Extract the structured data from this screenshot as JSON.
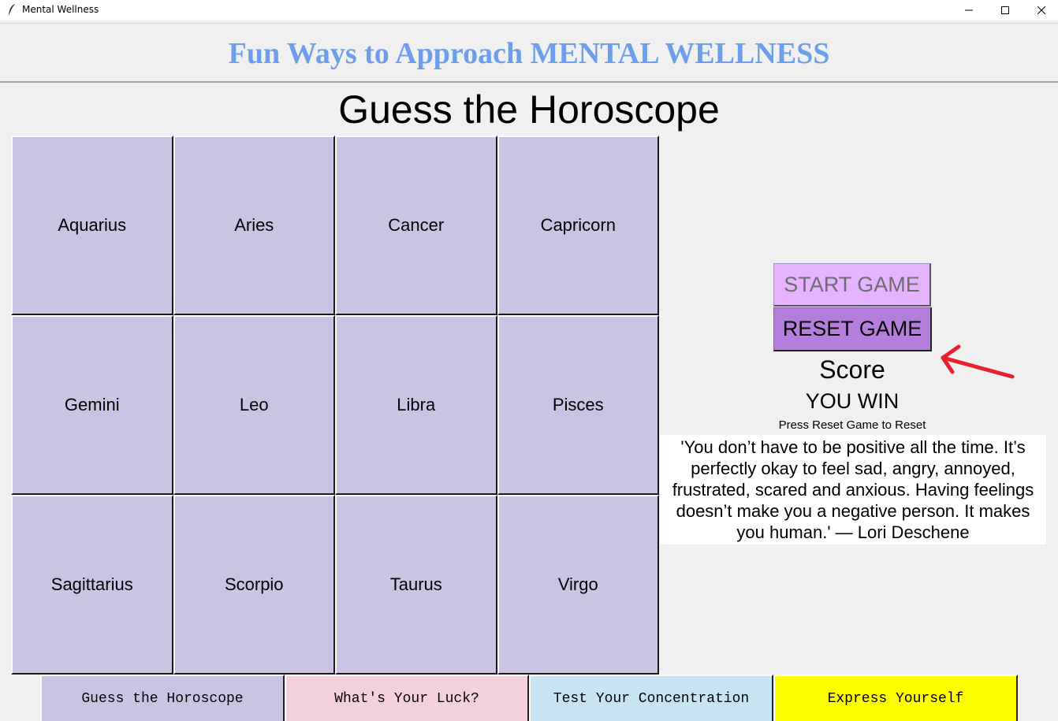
{
  "window": {
    "title": "Mental Wellness"
  },
  "header": {
    "title": "Fun Ways to Approach MENTAL WELLNESS"
  },
  "game": {
    "title": "Guess the Horoscope",
    "cells": [
      "Aquarius",
      "Aries",
      "Cancer",
      "Capricorn",
      "Gemini",
      "Leo",
      "Libra",
      "Pisces",
      "Sagittarius",
      "Scorpio",
      "Taurus",
      "Virgo"
    ]
  },
  "panel": {
    "start_label": "START GAME",
    "reset_label": "RESET GAME",
    "score_label": "Score",
    "result": "YOU WIN",
    "hint": "Press Reset Game to Reset",
    "quote": "'You don’t have to be positive all the time. It’s perfectly okay to feel sad, angry, annoyed, frustrated, scared and anxious. Having feelings doesn’t make you a negative person. It makes you human.' — Lori Deschene"
  },
  "tabs": [
    "Guess the Horoscope",
    "What's Your Luck?",
    "Test Your Concentration",
    "Express Yourself"
  ],
  "colors": {
    "banner_text": "#6d9eeb",
    "cell_bg": "#cbc3e3",
    "start_button": "#e6b3ff",
    "reset_button": "#b57edc",
    "annotation_arrow": "#e8212e",
    "tab_luck": "#f4d0dd",
    "tab_concentration": "#c7e4f2",
    "tab_express": "#ffff00"
  },
  "icons": {
    "app": "feather-icon",
    "minimize": "minimize-icon",
    "maximize": "maximize-icon",
    "close": "close-icon",
    "annotation": "arrow-annotation"
  }
}
